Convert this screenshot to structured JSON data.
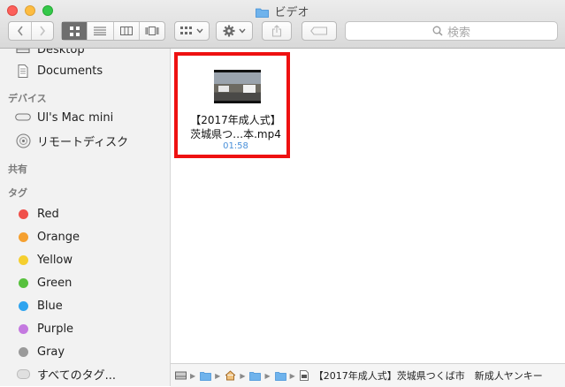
{
  "window": {
    "title": "ビデオ",
    "colors": {
      "close": "#fc605b",
      "minimize": "#fdbc40",
      "maximize": "#34c84a"
    }
  },
  "toolbar": {
    "search_placeholder": "検索",
    "view_modes": [
      "icon-view",
      "list-view",
      "column-view",
      "cover-flow-view"
    ],
    "active_view": "icon-view"
  },
  "sidebar": {
    "partial_item": "Desktop",
    "documents": "Documents",
    "devices_header": "デバイス",
    "devices": [
      {
        "label": "Ul's Mac mini",
        "icon": "mac-mini-icon"
      },
      {
        "label": "リモートディスク",
        "icon": "disc-icon"
      }
    ],
    "shared_header": "共有",
    "tags_header": "タグ",
    "tags": [
      {
        "label": "Red",
        "color": "#f0504a"
      },
      {
        "label": "Orange",
        "color": "#f5a030"
      },
      {
        "label": "Yellow",
        "color": "#f5cf2f"
      },
      {
        "label": "Green",
        "color": "#57c13d"
      },
      {
        "label": "Blue",
        "color": "#2fa4ef"
      },
      {
        "label": "Purple",
        "color": "#c479e0"
      },
      {
        "label": "Gray",
        "color": "#9a9a9a"
      }
    ],
    "all_tags": "すべてのタグ..."
  },
  "file": {
    "name_line1": "【2017年成人式】",
    "name_line2": "茨城県つ…本.mp4",
    "duration": "01:58",
    "selection_color": "#ee1111"
  },
  "pathbar": {
    "filename": "【2017年成人式】茨城県つくば市　新成人ヤンキー"
  }
}
